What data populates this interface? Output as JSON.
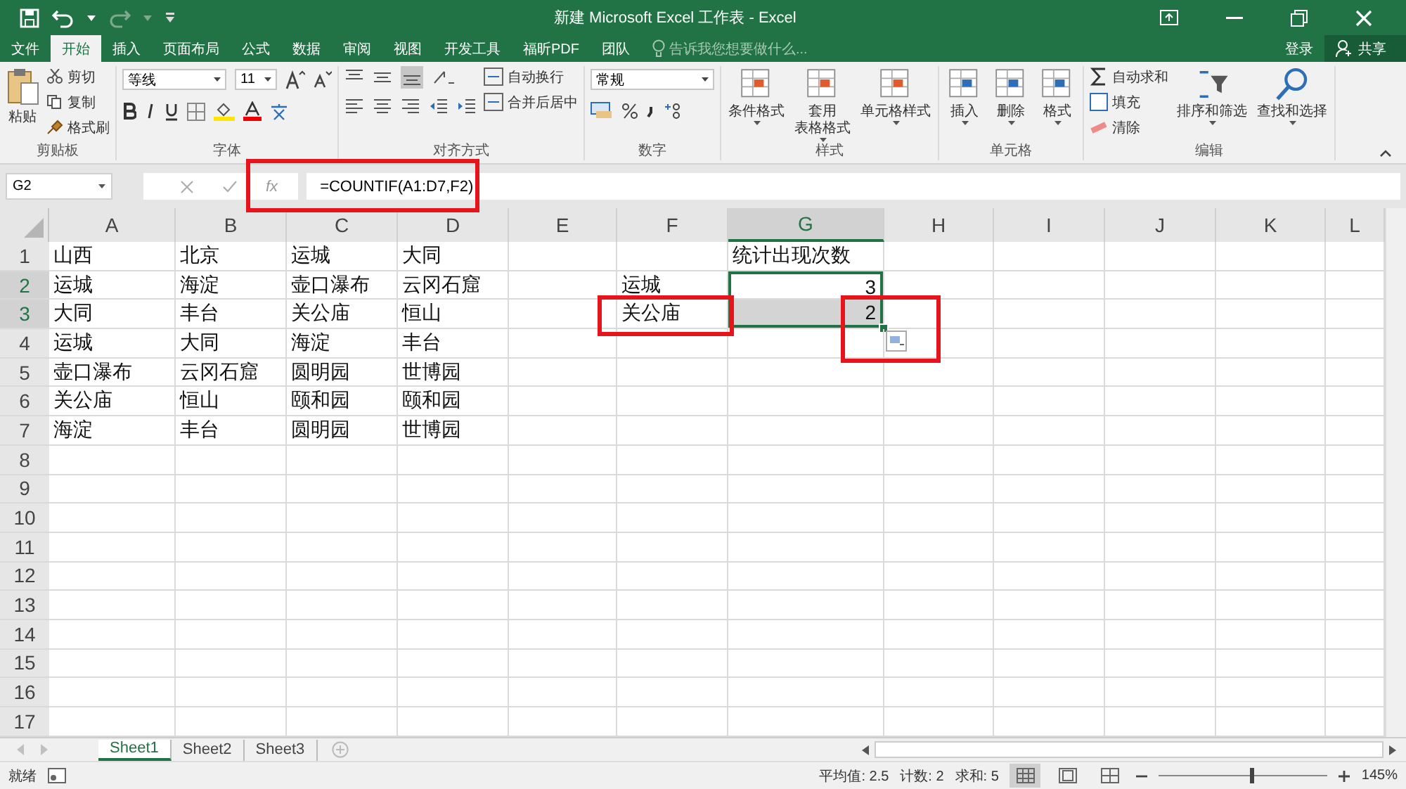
{
  "window": {
    "title": "新建 Microsoft Excel 工作表 - Excel"
  },
  "ribbon_tabs": [
    {
      "label": "文件",
      "selected": false
    },
    {
      "label": "开始",
      "selected": true
    },
    {
      "label": "插入",
      "selected": false
    },
    {
      "label": "页面布局",
      "selected": false
    },
    {
      "label": "公式",
      "selected": false
    },
    {
      "label": "数据",
      "selected": false
    },
    {
      "label": "审阅",
      "selected": false
    },
    {
      "label": "视图",
      "selected": false
    },
    {
      "label": "开发工具",
      "selected": false
    },
    {
      "label": "福昕PDF",
      "selected": false
    },
    {
      "label": "团队",
      "selected": false
    }
  ],
  "tell_me": "告诉我您想要做什么...",
  "login": "登录",
  "share": "共享",
  "ribbon_groups": [
    {
      "kind": "clipboard",
      "label": "剪贴板",
      "large": "粘贴",
      "small": [
        "剪切",
        "复制",
        "格式刷"
      ]
    },
    {
      "kind": "font",
      "label": "字体",
      "font": "等线",
      "size": "11"
    },
    {
      "kind": "alignment",
      "label": "对齐方式",
      "small": [
        "自动换行",
        "合并后居中"
      ]
    },
    {
      "kind": "number",
      "label": "数字",
      "format": "常规"
    },
    {
      "kind": "large",
      "label": "样式",
      "buttons": [
        [
          "条件格式"
        ],
        [
          "套用",
          "表格格式"
        ],
        [
          "单元格样式"
        ]
      ]
    },
    {
      "kind": "large",
      "label": "单元格",
      "buttons": [
        [
          "插入"
        ],
        [
          "删除"
        ],
        [
          "格式"
        ]
      ]
    },
    {
      "kind": "editing",
      "label": "编辑",
      "small": [
        "自动求和",
        "填充",
        "清除"
      ],
      "large": [
        "排序和筛选",
        "查找和选择"
      ]
    }
  ],
  "formula_bar": {
    "name_box": "G2",
    "function_button": "fx",
    "formula": "=COUNTIF(A1:D7,F2)"
  },
  "columns": [
    {
      "label": "A",
      "selected": false
    },
    {
      "label": "B",
      "selected": false
    },
    {
      "label": "C",
      "selected": false
    },
    {
      "label": "D",
      "selected": false
    },
    {
      "label": "E",
      "selected": false
    },
    {
      "label": "F",
      "selected": false
    },
    {
      "label": "G",
      "selected": true
    },
    {
      "label": "H",
      "selected": false
    },
    {
      "label": "I",
      "selected": false
    },
    {
      "label": "J",
      "selected": false
    },
    {
      "label": "K",
      "selected": false
    },
    {
      "label": "L",
      "selected": false
    }
  ],
  "rows": [
    {
      "label": "1",
      "selected": false,
      "cells": {
        "A": {
          "text": "山西",
          "kind": "text",
          "selected": false
        },
        "B": {
          "text": "北京",
          "kind": "text",
          "selected": false
        },
        "C": {
          "text": "运城",
          "kind": "text",
          "selected": false
        },
        "D": {
          "text": "大同",
          "kind": "text",
          "selected": false
        },
        "G": {
          "text": "统计出现次数",
          "kind": "text",
          "selected": false
        }
      }
    },
    {
      "label": "2",
      "selected": true,
      "cells": {
        "A": {
          "text": "运城",
          "kind": "text",
          "selected": false
        },
        "B": {
          "text": "海淀",
          "kind": "text",
          "selected": false
        },
        "C": {
          "text": "壶口瀑布",
          "kind": "text",
          "selected": false
        },
        "D": {
          "text": "云冈石窟",
          "kind": "text",
          "selected": false
        },
        "F": {
          "text": "运城",
          "kind": "text",
          "selected": false
        },
        "G": {
          "text": "3",
          "kind": "number",
          "selected": true
        }
      }
    },
    {
      "label": "3",
      "selected": true,
      "cells": {
        "A": {
          "text": "大同",
          "kind": "text",
          "selected": false
        },
        "B": {
          "text": "丰台",
          "kind": "text",
          "selected": false
        },
        "C": {
          "text": "关公庙",
          "kind": "text",
          "selected": false
        },
        "D": {
          "text": "恒山",
          "kind": "text",
          "selected": false
        },
        "F": {
          "text": "关公庙",
          "kind": "text",
          "selected": false
        },
        "G": {
          "text": "2",
          "kind": "number",
          "selected": true
        }
      }
    },
    {
      "label": "4",
      "selected": false,
      "cells": {
        "A": {
          "text": "运城",
          "kind": "text",
          "selected": false
        },
        "B": {
          "text": "大同",
          "kind": "text",
          "selected": false
        },
        "C": {
          "text": "海淀",
          "kind": "text",
          "selected": false
        },
        "D": {
          "text": "丰台",
          "kind": "text",
          "selected": false
        }
      }
    },
    {
      "label": "5",
      "selected": false,
      "cells": {
        "A": {
          "text": "壶口瀑布",
          "kind": "text",
          "selected": false
        },
        "B": {
          "text": "云冈石窟",
          "kind": "text",
          "selected": false
        },
        "C": {
          "text": "圆明园",
          "kind": "text",
          "selected": false
        },
        "D": {
          "text": "世博园",
          "kind": "text",
          "selected": false
        }
      }
    },
    {
      "label": "6",
      "selected": false,
      "cells": {
        "A": {
          "text": "关公庙",
          "kind": "text",
          "selected": false
        },
        "B": {
          "text": "恒山",
          "kind": "text",
          "selected": false
        },
        "C": {
          "text": "颐和园",
          "kind": "text",
          "selected": false
        },
        "D": {
          "text": "颐和园",
          "kind": "text",
          "selected": false
        }
      }
    },
    {
      "label": "7",
      "selected": false,
      "cells": {
        "A": {
          "text": "海淀",
          "kind": "text",
          "selected": false
        },
        "B": {
          "text": "丰台",
          "kind": "text",
          "selected": false
        },
        "C": {
          "text": "圆明园",
          "kind": "text",
          "selected": false
        },
        "D": {
          "text": "世博园",
          "kind": "text",
          "selected": false
        }
      }
    },
    {
      "label": "8",
      "selected": false
    },
    {
      "label": "9",
      "selected": false
    },
    {
      "label": "10",
      "selected": false
    },
    {
      "label": "11",
      "selected": false
    },
    {
      "label": "12",
      "selected": false
    },
    {
      "label": "13",
      "selected": false
    },
    {
      "label": "14",
      "selected": false
    },
    {
      "label": "15",
      "selected": false
    },
    {
      "label": "16",
      "selected": false
    },
    {
      "label": "17",
      "selected": false
    }
  ],
  "sheet_tabs": [
    {
      "label": "Sheet1",
      "selected": true
    },
    {
      "label": "Sheet2",
      "selected": false
    },
    {
      "label": "Sheet3",
      "selected": false
    }
  ],
  "status_bar": {
    "mode": "就绪",
    "stats": [
      "平均值: 2.5",
      "计数: 2",
      "求和: 5"
    ],
    "views": [
      {
        "selected": true
      },
      {
        "selected": false
      },
      {
        "selected": false
      }
    ],
    "zoom": {
      "level": 0.55,
      "reading": "145%"
    }
  }
}
